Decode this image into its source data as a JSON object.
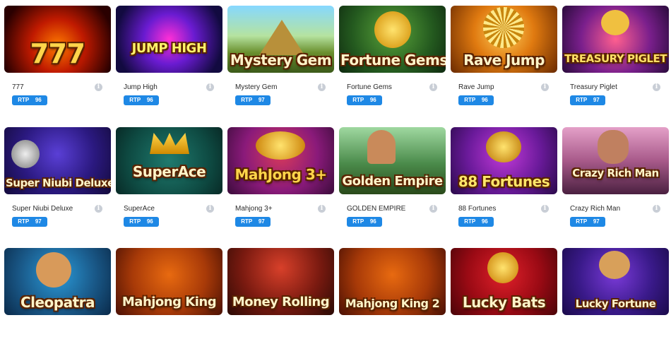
{
  "rtp_label": "RTP",
  "games": [
    {
      "name": "777",
      "logo": "777",
      "rtp": "96"
    },
    {
      "name": "Jump High",
      "logo": "JUMP HIGH",
      "rtp": "96"
    },
    {
      "name": "Mystery Gem",
      "logo": "Mystery Gem",
      "rtp": "97"
    },
    {
      "name": "Fortune Gems",
      "logo": "Fortune Gems",
      "rtp": "96"
    },
    {
      "name": "Rave Jump",
      "logo": "Rave Jump",
      "rtp": "96"
    },
    {
      "name": "Treasury Piglet",
      "logo": "TREASURY PIGLET",
      "rtp": "97"
    },
    {
      "name": "Super Niubi Deluxe",
      "logo": "Super Niubi Deluxe",
      "rtp": "97"
    },
    {
      "name": "SuperAce",
      "logo": "SuperAce",
      "rtp": "96"
    },
    {
      "name": "Mahjong 3+",
      "logo": "MahJong 3+",
      "rtp": "97"
    },
    {
      "name": "GOLDEN EMPIRE",
      "logo": "Golden Empire",
      "rtp": "96"
    },
    {
      "name": "88 Fortunes",
      "logo": "88 Fortunes",
      "rtp": "96"
    },
    {
      "name": "Crazy Rich Man",
      "logo": "Crazy Rich Man",
      "rtp": "97"
    },
    {
      "name": "",
      "logo": "Cleopatra",
      "rtp": ""
    },
    {
      "name": "",
      "logo": "Mahjong King",
      "rtp": ""
    },
    {
      "name": "",
      "logo": "Money Rolling",
      "rtp": ""
    },
    {
      "name": "",
      "logo": "Mahjong King 2",
      "rtp": ""
    },
    {
      "name": "",
      "logo": "Lucky Bats",
      "rtp": ""
    },
    {
      "name": "",
      "logo": "Lucky Fortune",
      "rtp": ""
    }
  ],
  "colors": {
    "rtp_badge": "#1e88e5",
    "info_icon": "#c9ced6"
  }
}
